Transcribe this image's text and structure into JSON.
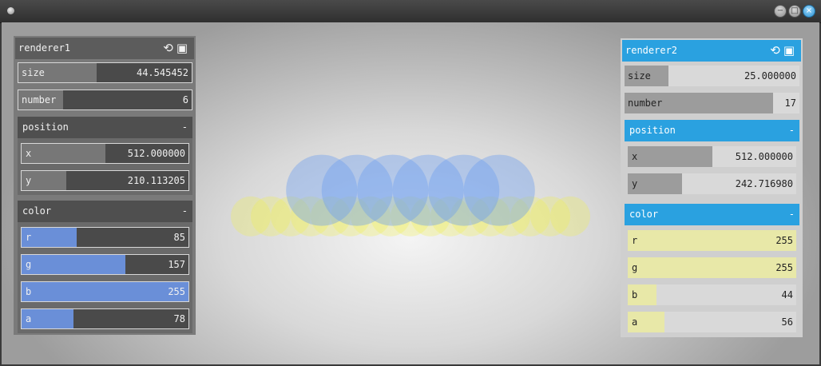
{
  "colors": {
    "renderer1_accent": "#6a8fd8",
    "renderer2_accent": "#e8e8a8",
    "renderer2_header": "#2aa1e0",
    "circle_blue": "#6a9cf0",
    "circle_yellow": "#f0f048"
  },
  "titlebar": {
    "app_icon": "circle-app-icon",
    "buttons": {
      "minimize": "−",
      "maximize": "□",
      "close": "×"
    }
  },
  "renderer1": {
    "title": "renderer1",
    "icons": [
      "refresh-icon",
      "save-icon"
    ],
    "size": {
      "label": "size",
      "value": "44.545452",
      "fill": 0.45
    },
    "number": {
      "label": "number",
      "value": "6",
      "fill": 0.26
    },
    "position": {
      "title": "position",
      "toggle": "-",
      "x": {
        "label": "x",
        "value": "512.000000",
        "fill": 0.5
      },
      "y": {
        "label": "y",
        "value": "210.113205",
        "fill": 0.27
      }
    },
    "color": {
      "title": "color",
      "toggle": "-",
      "r": {
        "label": "r",
        "value": "85",
        "fill": 0.33
      },
      "g": {
        "label": "g",
        "value": "157",
        "fill": 0.62
      },
      "b": {
        "label": "b",
        "value": "255",
        "fill": 1.0
      },
      "a": {
        "label": "a",
        "value": "78",
        "fill": 0.31
      }
    }
  },
  "renderer2": {
    "title": "renderer2",
    "icons": [
      "refresh-icon",
      "save-icon"
    ],
    "size": {
      "label": "size",
      "value": "25.000000",
      "fill": 0.25
    },
    "number": {
      "label": "number",
      "value": "17",
      "fill": 0.85
    },
    "position": {
      "title": "position",
      "toggle": "-",
      "x": {
        "label": "x",
        "value": "512.000000",
        "fill": 0.5
      },
      "y": {
        "label": "y",
        "value": "242.716980",
        "fill": 0.32
      }
    },
    "color": {
      "title": "color",
      "toggle": "-",
      "r": {
        "label": "r",
        "value": "255",
        "fill": 1.0
      },
      "g": {
        "label": "g",
        "value": "255",
        "fill": 1.0
      },
      "b": {
        "label": "b",
        "value": "44",
        "fill": 0.17
      },
      "a": {
        "label": "a",
        "value": "56",
        "fill": 0.22
      }
    }
  }
}
